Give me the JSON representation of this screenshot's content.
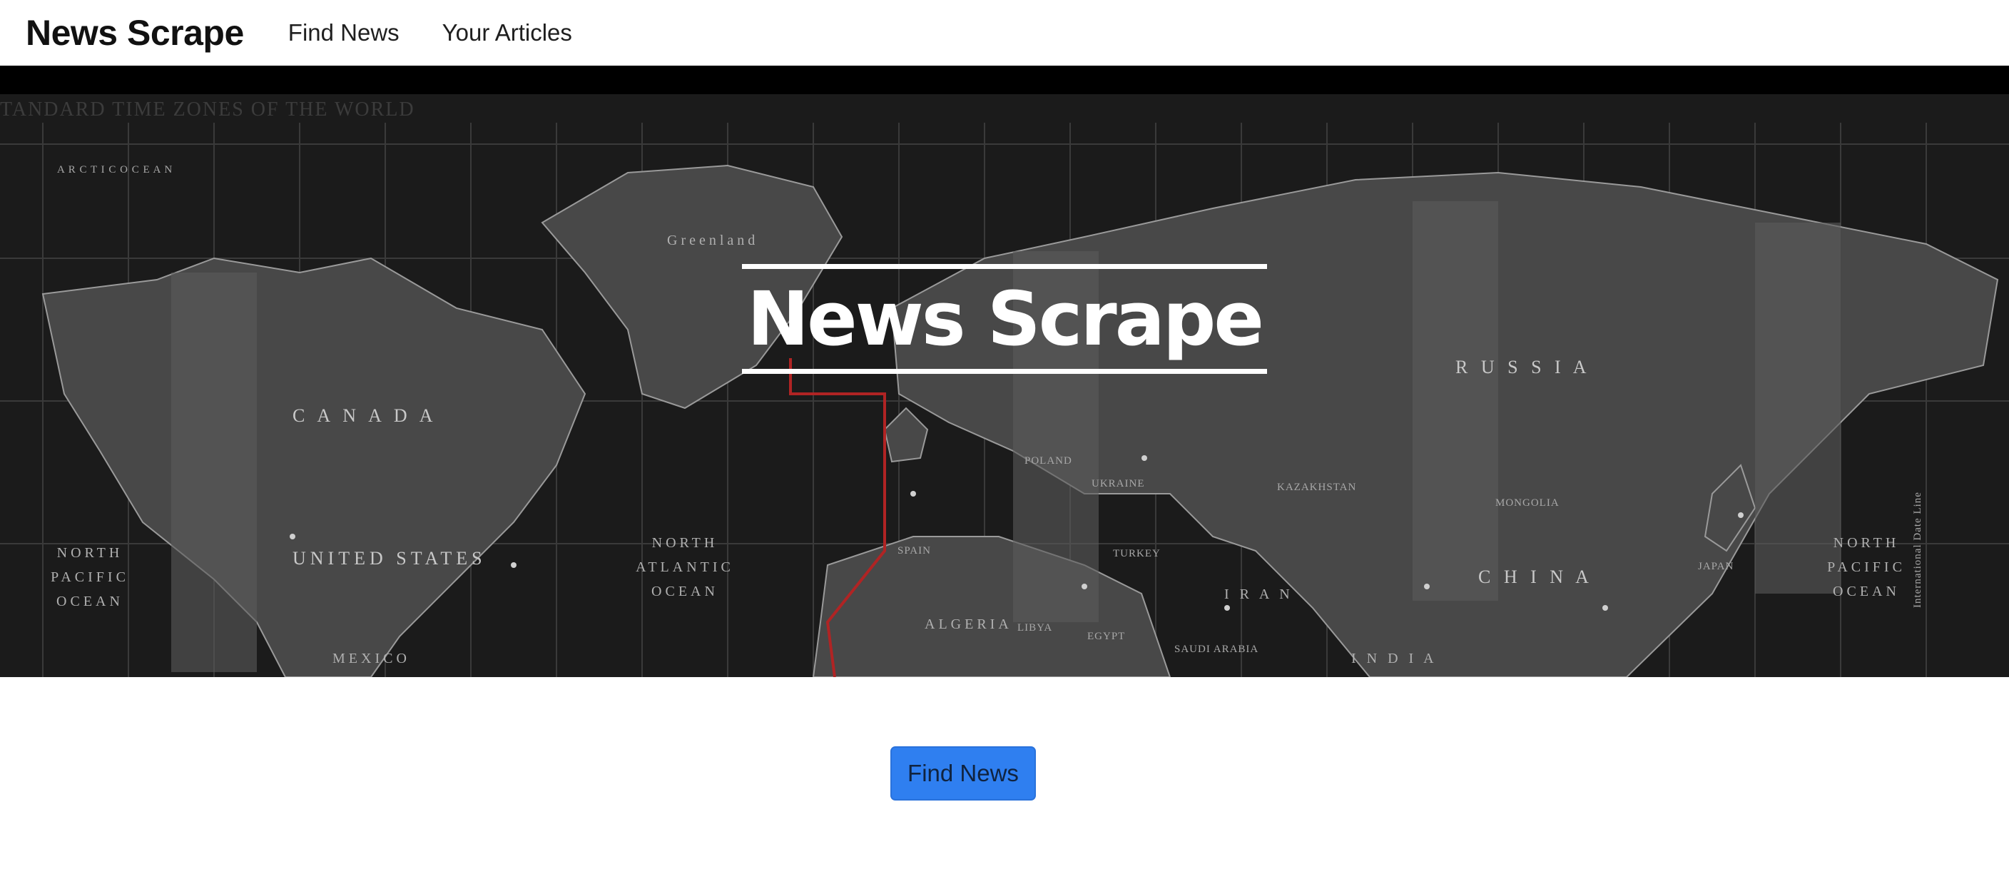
{
  "navbar": {
    "brand": "News Scrape",
    "links": [
      "Find News",
      "Your Articles"
    ]
  },
  "hero": {
    "title": "News Scrape",
    "map_caption": "TANDARD TIME ZONES OF THE WORLD",
    "map_labels": {
      "greenland": "Greenland",
      "canada": "C A N A D A",
      "united_states": "UNITED STATES",
      "russia": "R U S S I A",
      "kazakhstan": "KAZAKHSTAN",
      "mongolia": "MONGOLIA",
      "china": "C H I N A",
      "iran": "I R A N",
      "algeria": "ALGERIA",
      "libya": "LIBYA",
      "egypt": "EGYPT",
      "saudi_arabia": "SAUDI ARABIA",
      "india": "I N D I A",
      "mexico": "MEXICO",
      "north_pacific_left": "NORTH PACIFIC OCEAN",
      "north_atlantic": "NORTH ATLANTIC OCEAN",
      "north_pacific_right": "NORTH PACIFIC OCEAN",
      "arctic_ocean": "A R C T I C   O C E A N",
      "turkey": "TURKEY",
      "spain": "SPAIN",
      "poland": "POLAND",
      "ukraine": "UKRAINE",
      "japan": "JAPAN",
      "international_date_line": "International Date Line"
    }
  },
  "cta": {
    "label": "Find News"
  },
  "colors": {
    "button": "#2f7ff0",
    "hero_bg": "#1a1a1a",
    "land": "#4a4a4a"
  }
}
